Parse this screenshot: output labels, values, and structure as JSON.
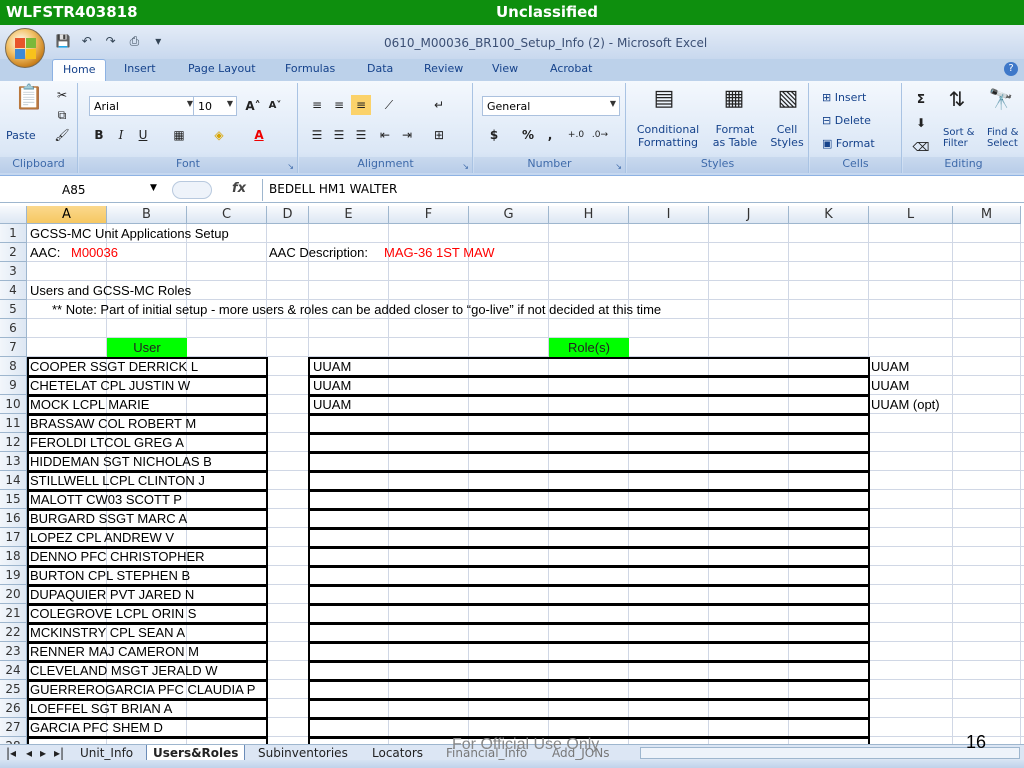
{
  "banner": {
    "left": "WLFSTR403818",
    "center": "Unclassified"
  },
  "window": {
    "title": "0610_M00036_BR100_Setup_Info (2) - Microsoft Excel"
  },
  "ribbon_tabs": [
    "Home",
    "Insert",
    "Page Layout",
    "Formulas",
    "Data",
    "Review",
    "View",
    "Acrobat"
  ],
  "ribbon": {
    "clipboard": {
      "label": "Clipboard",
      "paste": "Paste"
    },
    "font": {
      "label": "Font",
      "name": "Arial",
      "size": "10"
    },
    "alignment": {
      "label": "Alignment"
    },
    "number": {
      "label": "Number",
      "format": "General",
      "currency": "$",
      "percent": "%",
      "comma": ","
    },
    "styles": {
      "label": "Styles",
      "conditional": "Conditional",
      "conditional2": "Formatting",
      "format_table": "Format",
      "format_table2": "as Table",
      "cell_styles": "Cell",
      "cell_styles2": "Styles"
    },
    "cells": {
      "label": "Cells",
      "insert": "Insert",
      "delete": "Delete",
      "format": "Format"
    },
    "editing": {
      "label": "Editing",
      "sort": "Sort &",
      "sort2": "Filter",
      "find": "Find &",
      "find2": "Select"
    }
  },
  "formula_bar": {
    "name_box": "A85",
    "fx": "fx",
    "content": "BEDELL HM1 WALTER"
  },
  "columns": [
    "A",
    "B",
    "C",
    "D",
    "E",
    "F",
    "G",
    "H",
    "I",
    "J",
    "K",
    "L",
    "M"
  ],
  "sheet": {
    "title": "GCSS-MC Unit Applications Setup",
    "aac_label": "AAC:",
    "aac_value": "M00036",
    "aac_desc_label": "AAC Description:",
    "aac_desc_value": "MAG-36 1ST MAW",
    "section": "Users and GCSS-MC Roles",
    "note": "** Note:  Part of initial setup - more users & roles can be added closer to “go-live” if not decided at this time",
    "user_header": "User",
    "roles_header": "Role(s)",
    "rows": [
      {
        "n": "8",
        "user": "COOPER SSGT DERRICK L",
        "role": "UUAM",
        "note": "UUAM"
      },
      {
        "n": "9",
        "user": "CHETELAT CPL JUSTIN W",
        "role": "UUAM",
        "note": "UUAM"
      },
      {
        "n": "10",
        "user": "MOCK LCPL MARIE",
        "role": "UUAM",
        "note": "UUAM (opt)"
      },
      {
        "n": "11",
        "user": "BRASSAW COL ROBERT M",
        "role": "",
        "note": ""
      },
      {
        "n": "12",
        "user": "FEROLDI LTCOL GREG A",
        "role": "",
        "note": ""
      },
      {
        "n": "13",
        "user": "HIDDEMAN SGT NICHOLAS B",
        "role": "",
        "note": ""
      },
      {
        "n": "14",
        "user": "STILLWELL LCPL CLINTON J",
        "role": "",
        "note": ""
      },
      {
        "n": "15",
        "user": "MALOTT CW03 SCOTT P",
        "role": "",
        "note": ""
      },
      {
        "n": "16",
        "user": "BURGARD SSGT MARC A",
        "role": "",
        "note": ""
      },
      {
        "n": "17",
        "user": "LOPEZ CPL ANDREW V",
        "role": "",
        "note": ""
      },
      {
        "n": "18",
        "user": "DENNO PFC CHRISTOPHER",
        "role": "",
        "note": ""
      },
      {
        "n": "19",
        "user": "BURTON CPL STEPHEN B",
        "role": "",
        "note": ""
      },
      {
        "n": "20",
        "user": "DUPAQUIER PVT JARED N",
        "role": "",
        "note": ""
      },
      {
        "n": "21",
        "user": "COLEGROVE LCPL ORIN S",
        "role": "",
        "note": ""
      },
      {
        "n": "22",
        "user": "MCKINSTRY CPL SEAN A",
        "role": "",
        "note": ""
      },
      {
        "n": "23",
        "user": "RENNER MAJ CAMERON M",
        "role": "",
        "note": ""
      },
      {
        "n": "24",
        "user": "CLEVELAND MSGT JERALD W",
        "role": "",
        "note": ""
      },
      {
        "n": "25",
        "user": "GUERREROGARCIA PFC CLAUDIA P",
        "role": "",
        "note": ""
      },
      {
        "n": "26",
        "user": "LOEFFEL SGT BRIAN A",
        "role": "",
        "note": ""
      },
      {
        "n": "27",
        "user": "GARCIA PFC SHEM D",
        "role": "",
        "note": ""
      }
    ]
  },
  "sheet_tabs": [
    "Unit_Info",
    "Users&Roles",
    "Subinventories",
    "Locators",
    "Financial_Info",
    "Add_JONs"
  ],
  "footer": {
    "watermark": "For Official Use Only",
    "page": "16"
  },
  "colors": {
    "banner": "#0e8f0e",
    "header_fill": "#00ff00",
    "red_text": "#ff0000"
  }
}
